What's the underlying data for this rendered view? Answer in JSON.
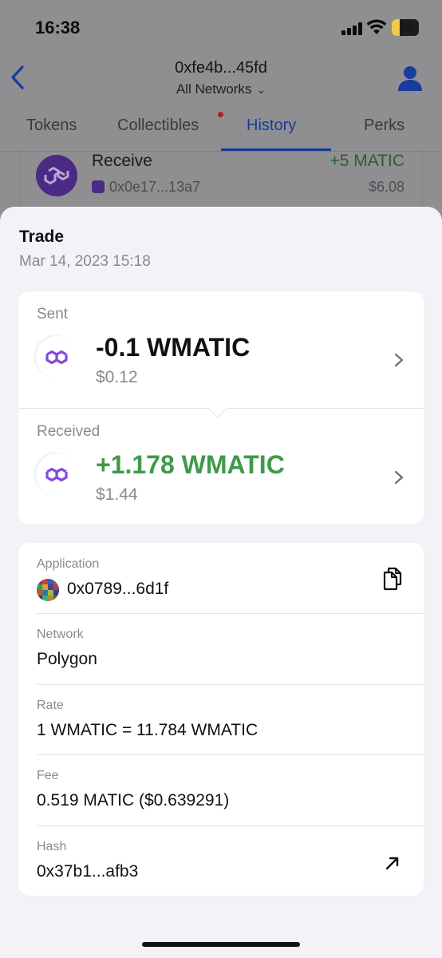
{
  "status_bar": {
    "time": "16:38",
    "battery": "30",
    "battery_level": 0.3
  },
  "header": {
    "title": "0xfe4b...45fd",
    "network_selector": "All Networks"
  },
  "tabs": [
    {
      "label": "Tokens"
    },
    {
      "label": "Collectibles",
      "has_notification_dot": true
    },
    {
      "label": "History",
      "active": true
    },
    {
      "label": "Perks"
    }
  ],
  "background_row": {
    "title": "Receive",
    "address": "0x0e17...13a7",
    "amount": "+5 MATIC",
    "value": "$6.08"
  },
  "sheet": {
    "title": "Trade",
    "date": "Mar 14, 2023 15:18",
    "sent": {
      "label": "Sent",
      "amount": "-0.1 WMATIC",
      "fiat": "$0.12"
    },
    "received": {
      "label": "Received",
      "amount": "+1.178 WMATIC",
      "fiat": "$1.44"
    },
    "details": {
      "application": {
        "label": "Application",
        "value": "0x0789...6d1f"
      },
      "network": {
        "label": "Network",
        "value": "Polygon"
      },
      "rate": {
        "label": "Rate",
        "value": "1 WMATIC = 11.784 WMATIC"
      },
      "fee": {
        "label": "Fee",
        "value": "0.519 MATIC ($0.639291)"
      },
      "hash": {
        "label": "Hash",
        "value": "0x37b1...afb3"
      }
    }
  },
  "icons": {
    "back": "chevron-left-icon",
    "network_dropdown": "chevron-down-icon",
    "profile": "user-icon",
    "token": "polygon-icon",
    "detail_arrow": "chevron-right-icon",
    "copy": "copy-icon",
    "external_link": "arrow-up-right-icon"
  },
  "colors": {
    "accent": "#1a3c9c",
    "positive": "#3e9a4a",
    "polygon_purple": "#8247e5",
    "sheet_background": "#f2f2f7",
    "notification_dot": "#b02020"
  }
}
